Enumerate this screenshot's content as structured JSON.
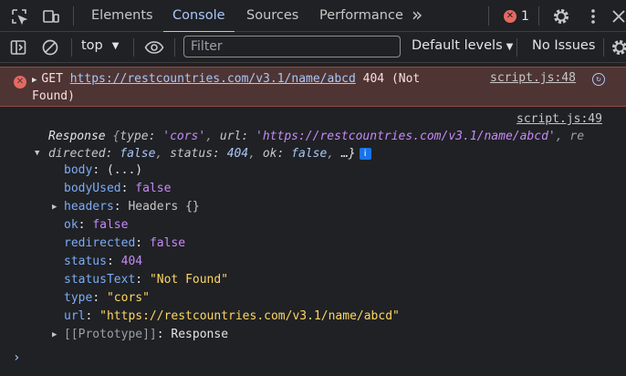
{
  "tabs": [
    {
      "label": "Elements"
    },
    {
      "label": "Console"
    },
    {
      "label": "Sources"
    },
    {
      "label": "Performance"
    }
  ],
  "more_tabs": "»",
  "error_badge": {
    "count": "1"
  },
  "toolbar": {
    "context": "top",
    "filter_placeholder": "Filter",
    "levels": "Default levels",
    "issues": "No Issues"
  },
  "error_message": {
    "method": "GET",
    "url": "https://restcountries.com/v3.1/name/abcd",
    "status_text": "404 (Not Found)",
    "source": "script.js:48"
  },
  "log": {
    "source": "script.js:49",
    "summary": {
      "prefix": "Response",
      "type": "'cors'",
      "url": "'https://restcountries.com/v3.1/name/abcd'",
      "redirected": "false",
      "status": "404",
      "ok": "false",
      "ellipsis": "…}"
    },
    "properties": [
      {
        "key": "body",
        "value": "(...)",
        "kind": "plain",
        "expandable": false
      },
      {
        "key": "bodyUsed",
        "value": "false",
        "kind": "bool",
        "expandable": false
      },
      {
        "key": "headers",
        "value": "Headers {}",
        "kind": "plain",
        "expandable": true
      },
      {
        "key": "ok",
        "value": "false",
        "kind": "bool",
        "expandable": false
      },
      {
        "key": "redirected",
        "value": "false",
        "kind": "bool",
        "expandable": false
      },
      {
        "key": "status",
        "value": "404",
        "kind": "num",
        "expandable": false
      },
      {
        "key": "statusText",
        "value": "\"Not Found\"",
        "kind": "str",
        "expandable": false
      },
      {
        "key": "type",
        "value": "\"cors\"",
        "kind": "str",
        "expandable": false
      },
      {
        "key": "url",
        "value": "\"https://restcountries.com/v3.1/name/abcd\"",
        "kind": "str",
        "expandable": false
      },
      {
        "key": "[[Prototype]]",
        "value": "Response",
        "kind": "plain",
        "expandable": true
      }
    ]
  },
  "prompt": "›"
}
